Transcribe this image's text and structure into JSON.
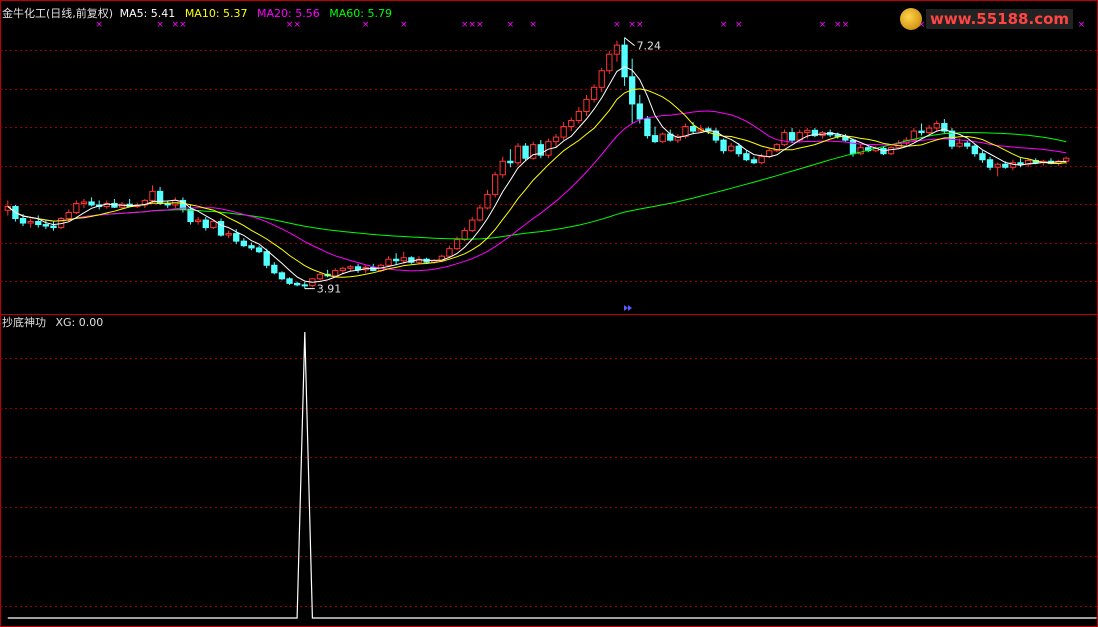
{
  "header": {
    "title": "金牛化工(日线,前复权)",
    "ma_labels": [
      {
        "text": "MA5: 5.41",
        "color": "#ffffff"
      },
      {
        "text": "MA10: 5.37",
        "color": "#ffff00"
      },
      {
        "text": "MA20: 5.56",
        "color": "#ff00ff"
      },
      {
        "text": "MA60: 5.79",
        "color": "#00ff00"
      }
    ]
  },
  "watermark": "www.55188.com",
  "indicator": {
    "title": "抄底神功",
    "value_label": "XG: 0.00"
  },
  "colors": {
    "up": "#ff3333",
    "down": "#54ffff",
    "ma5": "#ffffff",
    "ma10": "#ffff00",
    "ma20": "#ff00ff",
    "ma60": "#00ff00",
    "grid": "#9a0000",
    "border": "#c00000",
    "marker": "#ff00ff"
  },
  "chart_data": [
    {
      "type": "candlestick",
      "ylim": [
        3.6,
        7.5
      ],
      "annotations": [
        {
          "text": "7.24",
          "at_index": 81,
          "price": 7.24
        },
        {
          "text": "3.91",
          "at_index": 39,
          "price": 3.91
        }
      ],
      "markers_at_indices": [
        12,
        20,
        22,
        23,
        37,
        38,
        47,
        52,
        60,
        61,
        62,
        66,
        69,
        80,
        82,
        83,
        94,
        96,
        107,
        109,
        110,
        118,
        120,
        122,
        126,
        131,
        135,
        138,
        139,
        141
      ],
      "candles": [
        [
          4.95,
          5.08,
          4.88,
          5.0
        ],
        [
          5.0,
          5.02,
          4.8,
          4.84
        ],
        [
          4.84,
          4.9,
          4.74,
          4.78
        ],
        [
          4.78,
          4.84,
          4.72,
          4.8
        ],
        [
          4.8,
          4.88,
          4.72,
          4.76
        ],
        [
          4.76,
          4.82,
          4.7,
          4.74
        ],
        [
          4.74,
          4.8,
          4.68,
          4.72
        ],
        [
          4.72,
          4.86,
          4.7,
          4.84
        ],
        [
          4.84,
          4.96,
          4.8,
          4.92
        ],
        [
          4.92,
          5.08,
          4.9,
          5.04
        ],
        [
          5.04,
          5.1,
          4.98,
          5.06
        ],
        [
          5.06,
          5.12,
          5.0,
          5.02
        ],
        [
          5.02,
          5.08,
          4.96,
          5.0
        ],
        [
          5.0,
          5.08,
          4.97,
          5.04
        ],
        [
          5.04,
          5.1,
          4.98,
          4.99
        ],
        [
          4.99,
          5.06,
          4.97,
          5.03
        ],
        [
          5.03,
          5.1,
          5.0,
          5.0
        ],
        [
          5.0,
          5.05,
          4.98,
          5.02
        ],
        [
          5.02,
          5.1,
          4.98,
          5.08
        ],
        [
          5.08,
          5.28,
          5.04,
          5.2
        ],
        [
          5.2,
          5.26,
          5.02,
          5.04
        ],
        [
          5.04,
          5.08,
          4.98,
          5.02
        ],
        [
          5.02,
          5.12,
          4.98,
          5.08
        ],
        [
          5.08,
          5.12,
          4.92,
          4.96
        ],
        [
          4.96,
          5.02,
          4.76,
          4.8
        ],
        [
          4.8,
          4.86,
          4.76,
          4.82
        ],
        [
          4.82,
          4.86,
          4.68,
          4.72
        ],
        [
          4.72,
          4.82,
          4.7,
          4.8
        ],
        [
          4.8,
          4.84,
          4.6,
          4.62
        ],
        [
          4.62,
          4.68,
          4.58,
          4.64
        ],
        [
          4.64,
          4.7,
          4.5,
          4.54
        ],
        [
          4.54,
          4.58,
          4.46,
          4.48
        ],
        [
          4.48,
          4.52,
          4.42,
          4.45
        ],
        [
          4.45,
          4.48,
          4.38,
          4.4
        ],
        [
          4.4,
          4.44,
          4.18,
          4.22
        ],
        [
          4.22,
          4.26,
          4.1,
          4.12
        ],
        [
          4.12,
          4.14,
          4.02,
          4.04
        ],
        [
          4.04,
          4.06,
          3.96,
          3.98
        ],
        [
          3.98,
          4.0,
          3.94,
          3.96
        ],
        [
          3.96,
          4.0,
          3.91,
          3.95
        ],
        [
          3.95,
          4.05,
          3.93,
          4.04
        ],
        [
          4.04,
          4.12,
          4.02,
          4.1
        ],
        [
          4.1,
          4.16,
          4.06,
          4.08
        ],
        [
          4.08,
          4.18,
          4.06,
          4.15
        ],
        [
          4.15,
          4.2,
          4.1,
          4.18
        ],
        [
          4.18,
          4.22,
          4.14,
          4.2
        ],
        [
          4.2,
          4.24,
          4.12,
          4.16
        ],
        [
          4.16,
          4.22,
          4.12,
          4.19
        ],
        [
          4.19,
          4.24,
          4.14,
          4.15
        ],
        [
          4.15,
          4.24,
          4.13,
          4.22
        ],
        [
          4.22,
          4.34,
          4.2,
          4.3
        ],
        [
          4.3,
          4.38,
          4.22,
          4.28
        ],
        [
          4.28,
          4.4,
          4.24,
          4.32
        ],
        [
          4.32,
          4.34,
          4.24,
          4.26
        ],
        [
          4.26,
          4.34,
          4.24,
          4.3
        ],
        [
          4.3,
          4.32,
          4.24,
          4.26
        ],
        [
          4.26,
          4.3,
          4.24,
          4.28
        ],
        [
          4.28,
          4.36,
          4.26,
          4.34
        ],
        [
          4.34,
          4.48,
          4.32,
          4.44
        ],
        [
          4.44,
          4.6,
          4.42,
          4.56
        ],
        [
          4.56,
          4.72,
          4.54,
          4.68
        ],
        [
          4.68,
          4.86,
          4.66,
          4.82
        ],
        [
          4.82,
          5.02,
          4.8,
          4.98
        ],
        [
          4.98,
          5.22,
          4.96,
          5.16
        ],
        [
          5.16,
          5.46,
          5.12,
          5.42
        ],
        [
          5.42,
          5.66,
          5.38,
          5.6
        ],
        [
          5.6,
          5.76,
          5.52,
          5.58
        ],
        [
          5.58,
          5.84,
          5.54,
          5.8
        ],
        [
          5.8,
          5.84,
          5.6,
          5.64
        ],
        [
          5.64,
          5.86,
          5.62,
          5.82
        ],
        [
          5.82,
          5.88,
          5.64,
          5.68
        ],
        [
          5.68,
          5.9,
          5.64,
          5.86
        ],
        [
          5.86,
          5.96,
          5.78,
          5.92
        ],
        [
          5.92,
          6.12,
          5.88,
          6.06
        ],
        [
          6.06,
          6.18,
          6.0,
          6.14
        ],
        [
          6.14,
          6.32,
          6.1,
          6.26
        ],
        [
          6.26,
          6.48,
          6.2,
          6.42
        ],
        [
          6.42,
          6.62,
          6.38,
          6.58
        ],
        [
          6.58,
          6.84,
          6.52,
          6.8
        ],
        [
          6.8,
          7.06,
          6.76,
          7.02
        ],
        [
          7.02,
          7.2,
          6.92,
          7.14
        ],
        [
          7.14,
          7.24,
          6.6,
          6.72
        ],
        [
          6.72,
          6.96,
          6.1,
          6.36
        ],
        [
          6.36,
          6.48,
          6.1,
          6.16
        ],
        [
          6.16,
          6.2,
          5.9,
          5.94
        ],
        [
          5.94,
          6.06,
          5.84,
          5.86
        ],
        [
          5.86,
          5.98,
          5.84,
          5.96
        ],
        [
          5.96,
          6.02,
          5.86,
          5.88
        ],
        [
          5.88,
          5.96,
          5.84,
          5.93
        ],
        [
          5.93,
          6.1,
          5.9,
          6.06
        ],
        [
          6.06,
          6.12,
          5.96,
          6.0
        ],
        [
          6.0,
          6.08,
          5.98,
          6.03
        ],
        [
          6.03,
          6.06,
          5.96,
          6.0
        ],
        [
          6.0,
          6.04,
          5.84,
          5.88
        ],
        [
          5.88,
          5.9,
          5.7,
          5.74
        ],
        [
          5.74,
          5.84,
          5.72,
          5.8
        ],
        [
          5.8,
          5.84,
          5.66,
          5.7
        ],
        [
          5.7,
          5.74,
          5.6,
          5.62
        ],
        [
          5.62,
          5.66,
          5.56,
          5.58
        ],
        [
          5.58,
          5.7,
          5.56,
          5.66
        ],
        [
          5.66,
          5.78,
          5.64,
          5.74
        ],
        [
          5.74,
          5.84,
          5.72,
          5.82
        ],
        [
          5.82,
          6.02,
          5.8,
          5.98
        ],
        [
          5.98,
          6.04,
          5.84,
          5.88
        ],
        [
          5.88,
          6.02,
          5.86,
          5.98
        ],
        [
          5.98,
          6.04,
          5.9,
          6.01
        ],
        [
          6.01,
          6.04,
          5.92,
          5.94
        ],
        [
          5.94,
          6.0,
          5.9,
          5.98
        ],
        [
          5.98,
          6.02,
          5.92,
          5.95
        ],
        [
          5.95,
          5.98,
          5.9,
          5.93
        ],
        [
          5.93,
          5.96,
          5.86,
          5.88
        ],
        [
          5.88,
          5.9,
          5.66,
          5.7
        ],
        [
          5.7,
          5.82,
          5.68,
          5.78
        ],
        [
          5.78,
          5.82,
          5.72,
          5.74
        ],
        [
          5.74,
          5.8,
          5.72,
          5.77
        ],
        [
          5.77,
          5.8,
          5.68,
          5.7
        ],
        [
          5.7,
          5.8,
          5.68,
          5.78
        ],
        [
          5.78,
          5.88,
          5.76,
          5.84
        ],
        [
          5.84,
          5.92,
          5.8,
          5.88
        ],
        [
          5.88,
          6.04,
          5.86,
          6.0
        ],
        [
          6.0,
          6.1,
          5.94,
          5.98
        ],
        [
          5.98,
          6.08,
          5.96,
          6.04
        ],
        [
          6.04,
          6.14,
          6.0,
          6.1
        ],
        [
          6.1,
          6.16,
          5.96,
          6.0
        ],
        [
          6.0,
          6.04,
          5.76,
          5.8
        ],
        [
          5.8,
          5.9,
          5.78,
          5.84
        ],
        [
          5.84,
          5.88,
          5.76,
          5.8
        ],
        [
          5.8,
          5.82,
          5.66,
          5.7
        ],
        [
          5.7,
          5.74,
          5.58,
          5.62
        ],
        [
          5.62,
          5.66,
          5.48,
          5.52
        ],
        [
          5.52,
          5.58,
          5.4,
          5.56
        ],
        [
          5.56,
          5.6,
          5.5,
          5.52
        ],
        [
          5.52,
          5.62,
          5.48,
          5.58
        ],
        [
          5.58,
          5.64,
          5.52,
          5.56
        ],
        [
          5.56,
          5.64,
          5.52,
          5.61
        ],
        [
          5.61,
          5.64,
          5.56,
          5.58
        ],
        [
          5.58,
          5.62,
          5.54,
          5.6
        ],
        [
          5.6,
          5.64,
          5.56,
          5.57
        ],
        [
          5.57,
          5.62,
          5.54,
          5.6
        ],
        [
          5.6,
          5.66,
          5.56,
          5.64
        ]
      ]
    },
    {
      "type": "line",
      "title": "抄底神功",
      "series": [
        {
          "name": "XG",
          "values": [
            0,
            0,
            0,
            0,
            0,
            0,
            0,
            0,
            0,
            0,
            0,
            0,
            0,
            0,
            0,
            0,
            0,
            0,
            0,
            0,
            0,
            0,
            0,
            0,
            0,
            0,
            0,
            0,
            0,
            0,
            0,
            0,
            0,
            0,
            0,
            0,
            0,
            0,
            0,
            1,
            0,
            0,
            0,
            0,
            0,
            0,
            0,
            0,
            0,
            0,
            0,
            0,
            0,
            0,
            0,
            0,
            0,
            0,
            0,
            0,
            0,
            0,
            0,
            0,
            0,
            0,
            0,
            0,
            0,
            0,
            0,
            0,
            0,
            0,
            0,
            0,
            0,
            0,
            0,
            0,
            0,
            0,
            0,
            0,
            0,
            0,
            0,
            0,
            0,
            0,
            0,
            0,
            0,
            0,
            0,
            0,
            0,
            0,
            0,
            0,
            0,
            0,
            0,
            0,
            0,
            0,
            0,
            0,
            0,
            0,
            0,
            0,
            0,
            0,
            0,
            0,
            0,
            0,
            0,
            0,
            0,
            0,
            0,
            0,
            0,
            0,
            0,
            0,
            0,
            0,
            0,
            0,
            0,
            0,
            0,
            0,
            0,
            0,
            0,
            0,
            0,
            0,
            0,
            0
          ]
        }
      ],
      "ylim": [
        0,
        1
      ]
    }
  ]
}
